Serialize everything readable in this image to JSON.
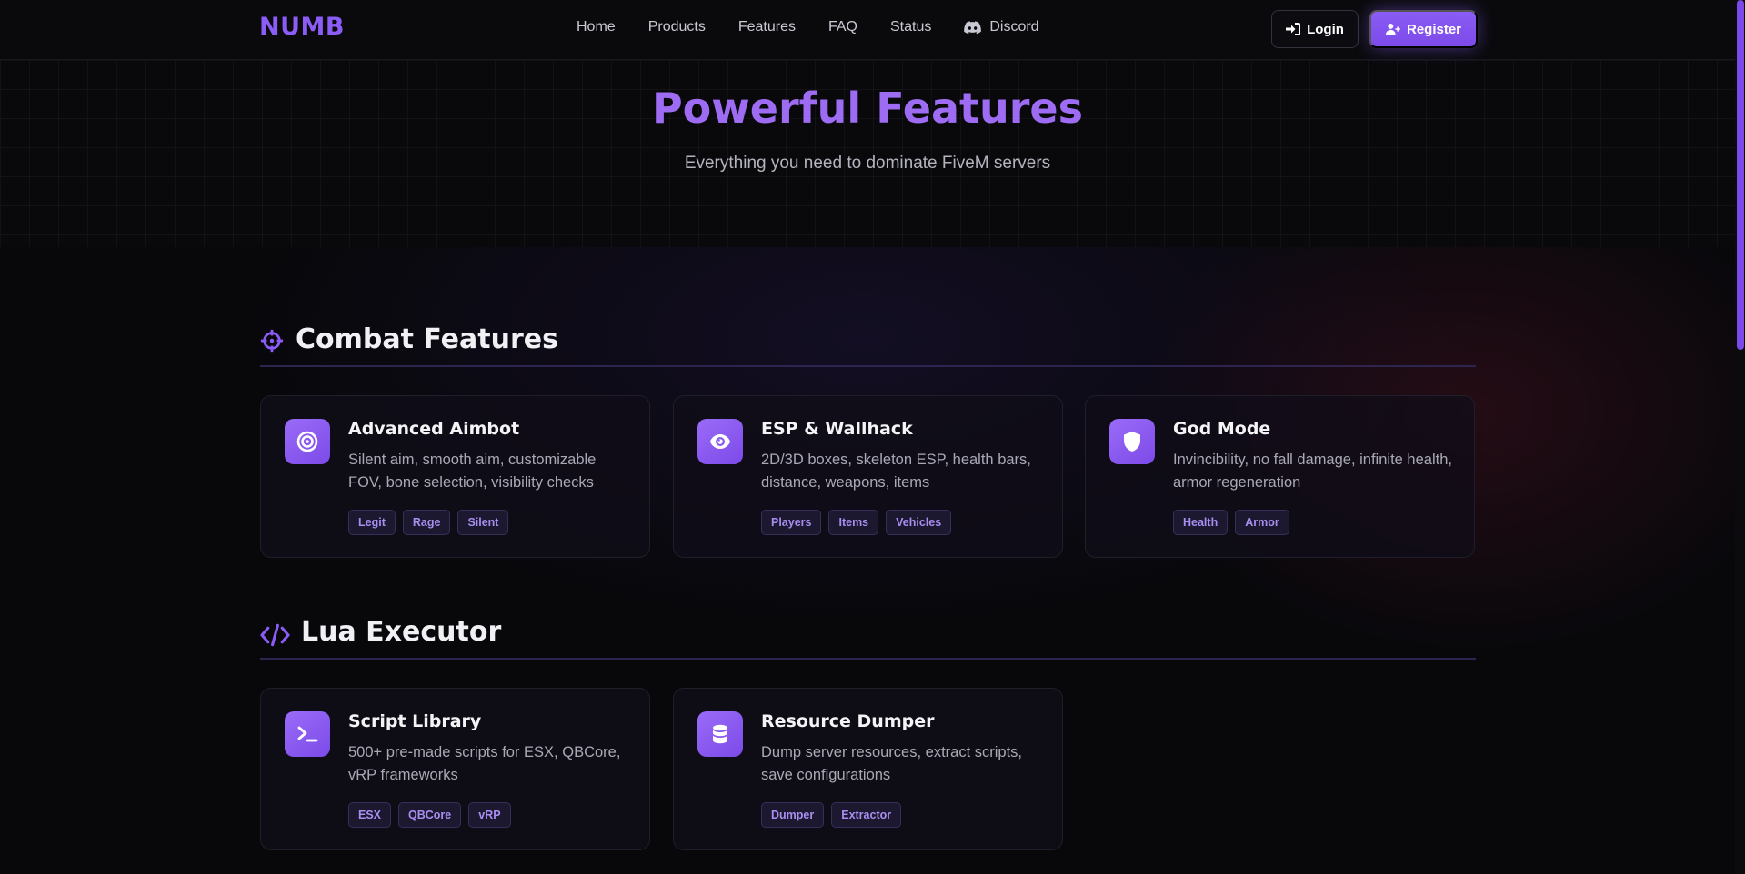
{
  "nav": {
    "logo": "NUMB",
    "links": [
      "Home",
      "Products",
      "Features",
      "FAQ",
      "Status"
    ],
    "discord_label": "Discord",
    "login_label": "Login",
    "register_label": "Register"
  },
  "hero": {
    "title": "Powerful Features",
    "subtitle": "Everything you need to dominate FiveM servers"
  },
  "sections": [
    {
      "title": "Combat Features",
      "icon": "crosshair-icon",
      "cards": [
        {
          "icon": "target-icon",
          "title": "Advanced Aimbot",
          "desc": "Silent aim, smooth aim, customizable FOV, bone selection, visibility checks",
          "tags": [
            "Legit",
            "Rage",
            "Silent"
          ]
        },
        {
          "icon": "eye-icon",
          "title": "ESP & Wallhack",
          "desc": "2D/3D boxes, skeleton ESP, health bars, distance, weapons, items",
          "tags": [
            "Players",
            "Items",
            "Vehicles"
          ]
        },
        {
          "icon": "shield-icon",
          "title": "God Mode",
          "desc": "Invincibility, no fall damage, infinite health, armor regeneration",
          "tags": [
            "Health",
            "Armor"
          ]
        }
      ]
    },
    {
      "title": "Lua Executor",
      "icon": "code-icon",
      "cards": [
        {
          "icon": "terminal-icon",
          "title": "Script Library",
          "desc": "500+ pre-made scripts for ESX, QBCore, vRP frameworks",
          "tags": [
            "ESX",
            "QBCore",
            "vRP"
          ]
        },
        {
          "icon": "database-icon",
          "title": "Resource Dumper",
          "desc": "Dump server resources, extract scripts, save configurations",
          "tags": [
            "Dumper",
            "Extractor"
          ]
        }
      ]
    }
  ],
  "colors": {
    "accent": "#8b5cf6",
    "background": "#08080b",
    "card": "#100e18",
    "tag_text": "#a98ef0"
  }
}
